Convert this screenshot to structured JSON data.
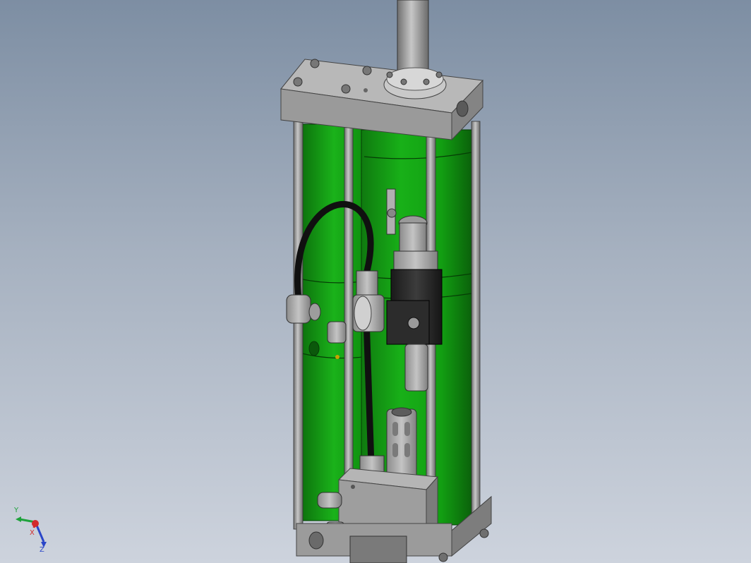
{
  "viewport": {
    "background_top": "#7d8ea3",
    "background_bottom": "#cdd3dd"
  },
  "model": {
    "part_colors": {
      "cylinder": "#1aa51a",
      "frame": "#8a8a8a",
      "hose": "#111111",
      "valve_block": "#2b2b2b"
    }
  },
  "triad": {
    "x_label": "X",
    "y_label": "Y",
    "z_label": "Z",
    "x_color": "#d22b2b",
    "y_color": "#1fa23c",
    "z_color": "#2a46c8"
  }
}
